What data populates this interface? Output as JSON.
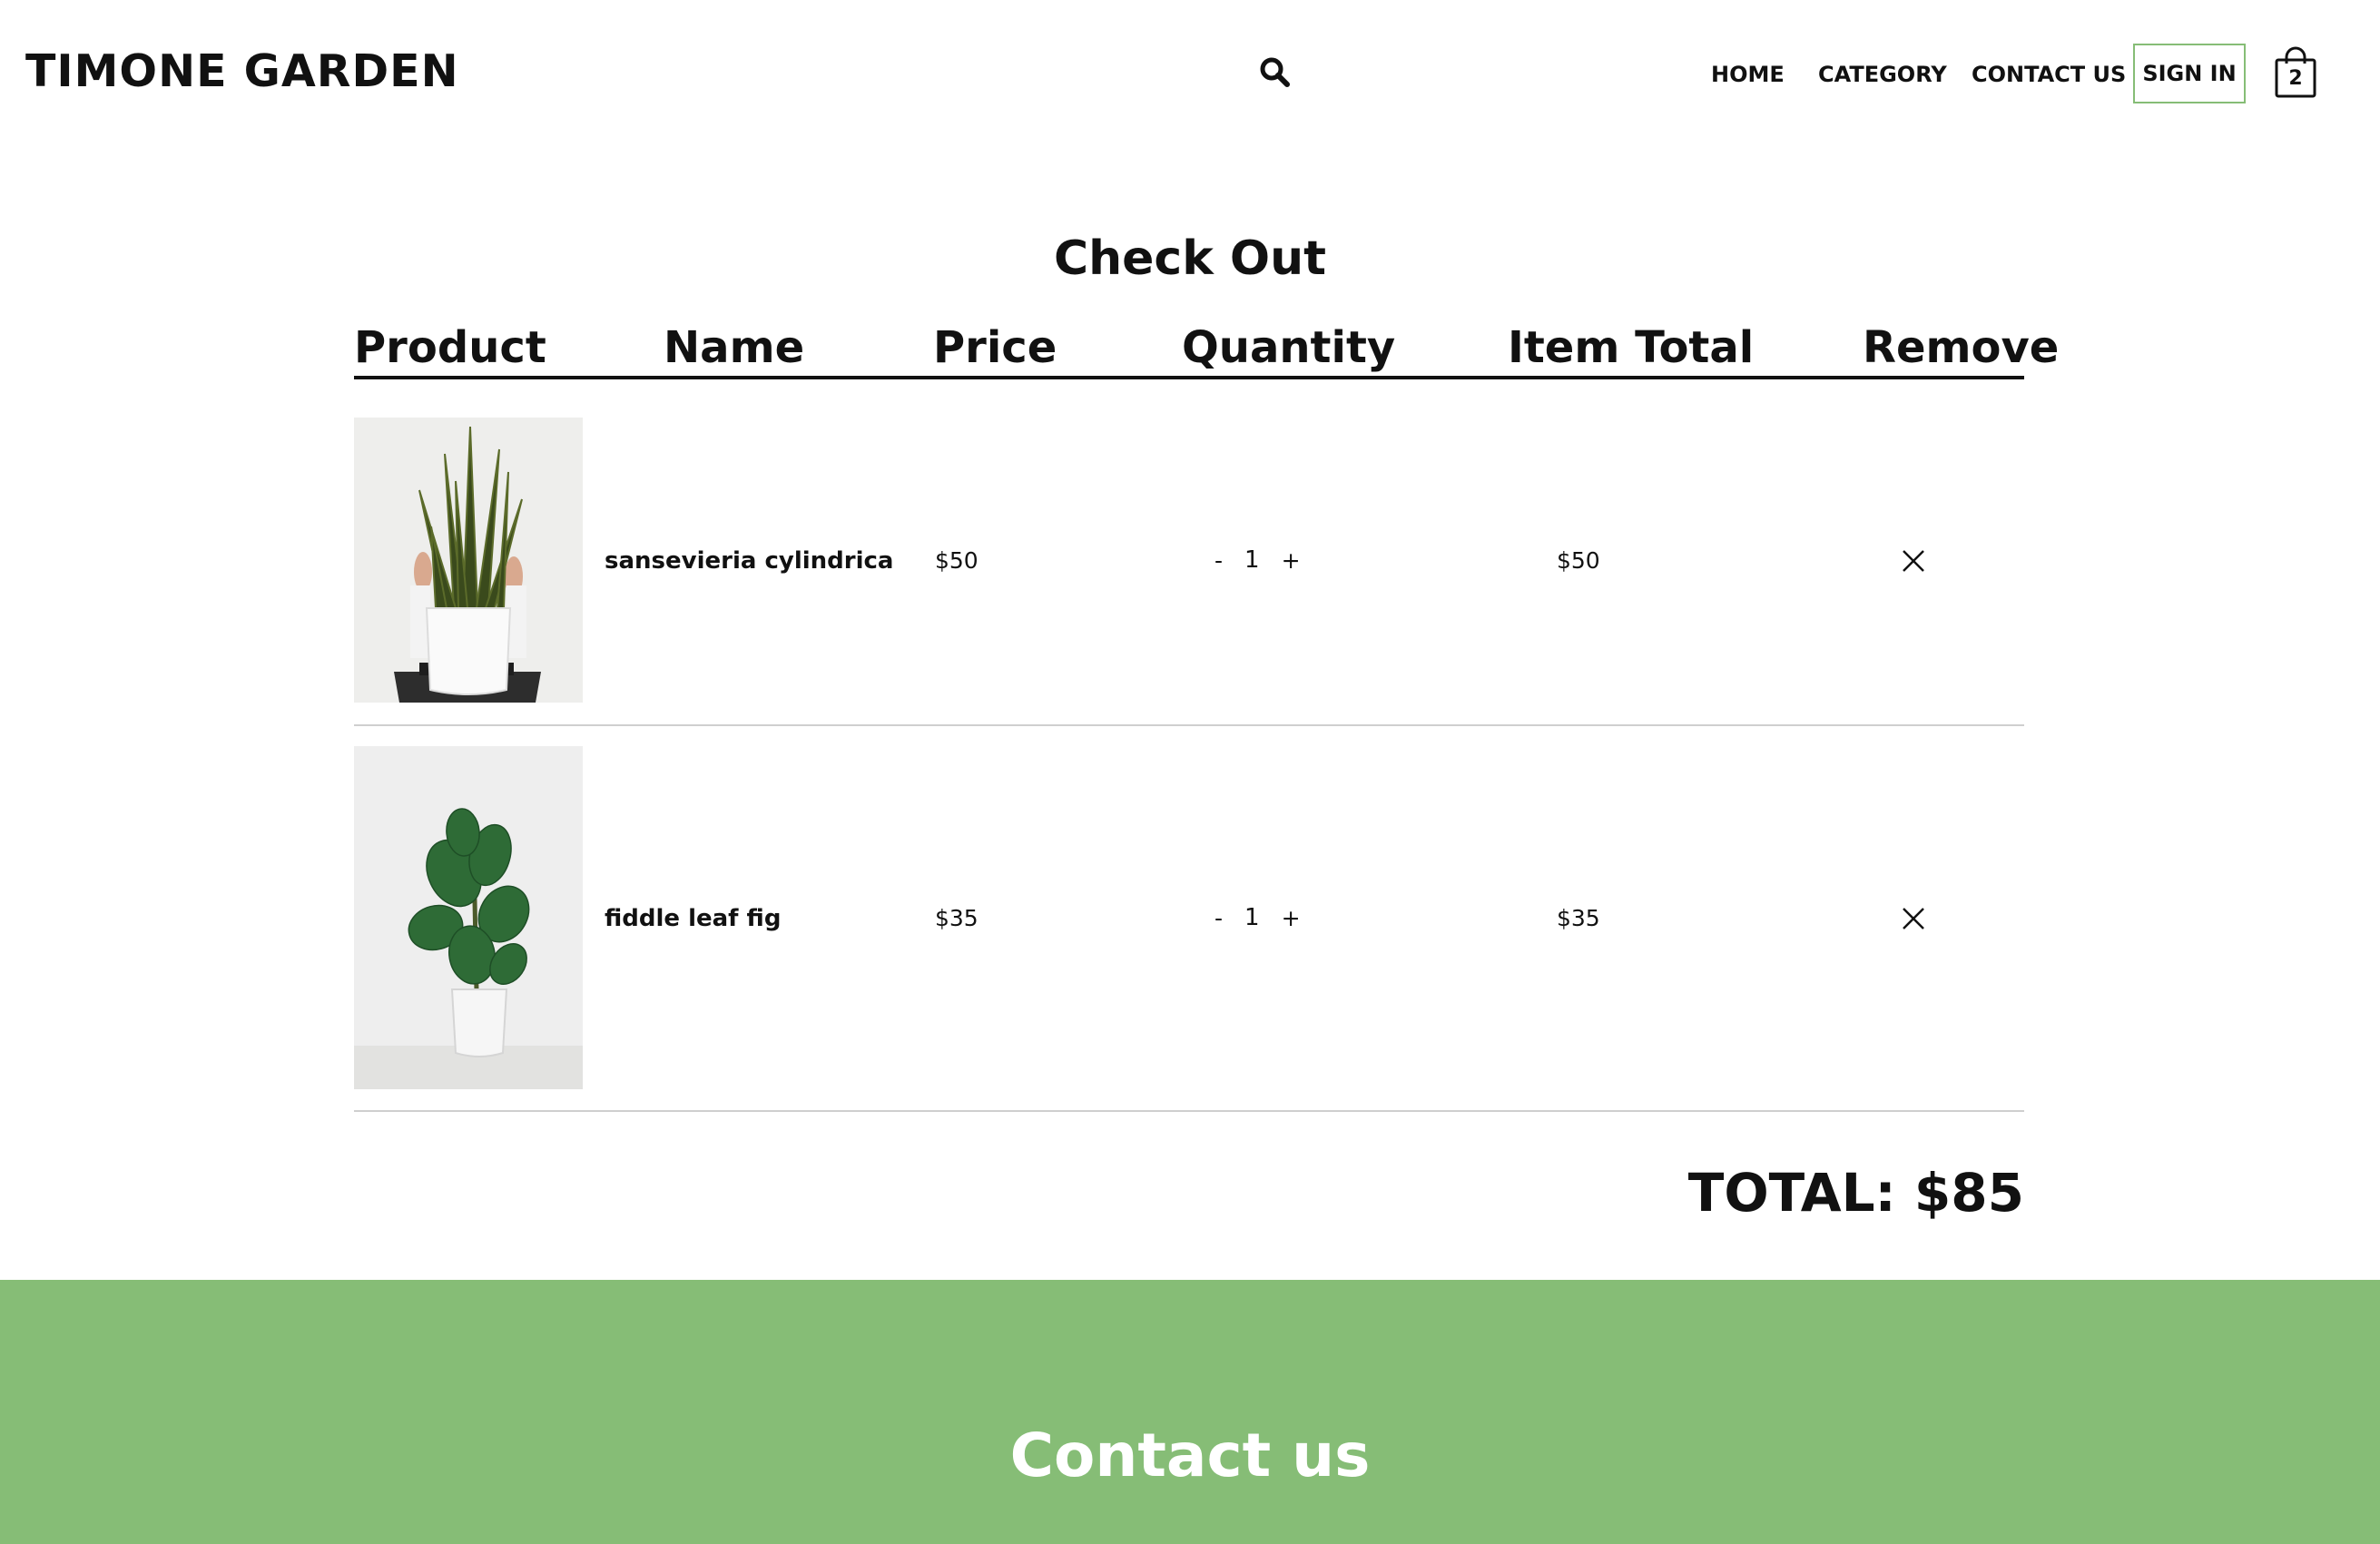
{
  "header": {
    "brand": "TIMONE GARDEN",
    "search_icon": "search-icon",
    "nav": [
      {
        "label": "HOME"
      },
      {
        "label": "CATEGORY"
      },
      {
        "label": "CONTACT US"
      }
    ],
    "sign_in": "SIGN IN",
    "cart_icon": "shopping-bag-icon",
    "cart_count": "2"
  },
  "checkout": {
    "title": "Check Out",
    "columns": [
      "Product",
      "Name",
      "Price",
      "Quantity",
      "Item Total",
      "Remove"
    ],
    "items": [
      {
        "image_icon": "sansevieria-plant-photo",
        "name": "sansevieria cylindrica",
        "price": "$50",
        "decrement": "-",
        "quantity": "1",
        "increment": "+",
        "item_total": "$50",
        "remove_icon": "close-icon"
      },
      {
        "image_icon": "fiddle-leaf-fig-photo",
        "name": "fiddle leaf fig",
        "price": "$35",
        "decrement": "-",
        "quantity": "1",
        "increment": "+",
        "item_total": "$35",
        "remove_icon": "close-icon"
      }
    ],
    "total": "TOTAL: $85"
  },
  "footer": {
    "title": "Contact us"
  },
  "colors": {
    "accent_green": "#86bd76",
    "text": "#111111",
    "background": "#ffffff"
  }
}
